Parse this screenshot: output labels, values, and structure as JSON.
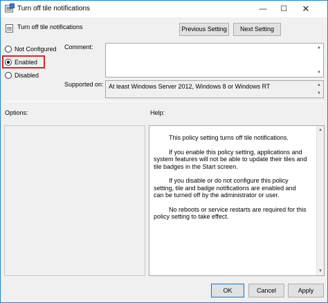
{
  "window": {
    "title": "Turn off tile notifications",
    "minimize": "—",
    "maximize": "☐",
    "close": "✕"
  },
  "header": {
    "policy_name": "Turn off tile notifications",
    "previous_label": "Previous Setting",
    "next_label": "Next Setting"
  },
  "state": {
    "options": [
      {
        "label": "Not Configured",
        "checked": false
      },
      {
        "label": "Enabled",
        "checked": true
      },
      {
        "label": "Disabled",
        "checked": false
      }
    ]
  },
  "comment": {
    "label": "Comment:",
    "value": ""
  },
  "supported": {
    "label": "Supported on:",
    "value": "At least Windows Server 2012, Windows 8 or Windows RT"
  },
  "panels": {
    "options_label": "Options:",
    "help_label": "Help:"
  },
  "help": {
    "paragraphs": [
      "This policy setting turns off tile notifications.",
      "If you enable this policy setting, applications and system features will not be able to update their tiles and tile badges in the Start screen.",
      "If you disable or do not configure this policy setting, tile and badge notifications are enabled and can be turned off by the administrator or user.",
      "No reboots or service restarts are required for this policy setting to take effect."
    ]
  },
  "footer": {
    "ok_label": "OK",
    "cancel_label": "Cancel",
    "apply_label": "Apply"
  },
  "icons": {
    "arrow_up": "▲",
    "arrow_down": "▼"
  },
  "colors": {
    "highlight": "#e0202c",
    "window_border": "#1883d7"
  }
}
